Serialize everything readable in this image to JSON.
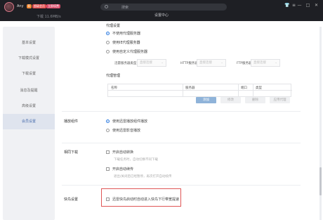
{
  "titlebar": {
    "username": "Any",
    "badge1": "8",
    "badge2": "超级会员",
    "badge3": "立即续费",
    "speed": "下载 11.6MB/s",
    "search_placeholder": "搜索",
    "window_title": "设置中心",
    "skin_glyph": "👕",
    "menu_glyph": "≡",
    "min_glyph": "—",
    "max_glyph": "□",
    "close_glyph": "✕"
  },
  "sidebar": {
    "items": [
      {
        "label": "基本设置"
      },
      {
        "label": "下载模式设置"
      },
      {
        "label": "下载设置"
      },
      {
        "label": "消息及提醒"
      },
      {
        "label": "高级设置"
      },
      {
        "label": "会员设置"
      }
    ],
    "active_index": 5
  },
  "proxy": {
    "title": "代理设置",
    "options": [
      "不使用代理服务器",
      "使用IE代理服务器",
      "使用自定义代理服务器"
    ],
    "selected_index": 0,
    "fields": [
      {
        "label": "迅雷服务器类型",
        "value": "直接连接"
      },
      {
        "label": "HTTP服务器",
        "value": "直接连接"
      },
      {
        "label": "FTP服务器",
        "value": "直接连接"
      }
    ],
    "manage_title": "代理管理",
    "columns": [
      "名称",
      "服务器",
      "端口",
      "类型"
    ],
    "buttons": [
      "添加",
      "修改",
      "删除",
      "应用代理"
    ]
  },
  "player": {
    "title": "播放组件",
    "options": [
      "使用迅雷播放组件播放",
      "使用迅雷影音播放"
    ],
    "selected_index": 0
  },
  "download": {
    "title": "相同下载",
    "checks": [
      {
        "label": "开启自动转换",
        "hint": "下载任务时，自动切换不同下载"
      },
      {
        "label": "开启自动续传",
        "hint": "退出/关闭后已经暂停，再次打开自动续传"
      }
    ]
  },
  "speed_setting": {
    "title": "快鸟设置",
    "check_label": "迅雷快鸟启动时自动进入快鸟下行带宽提速"
  }
}
